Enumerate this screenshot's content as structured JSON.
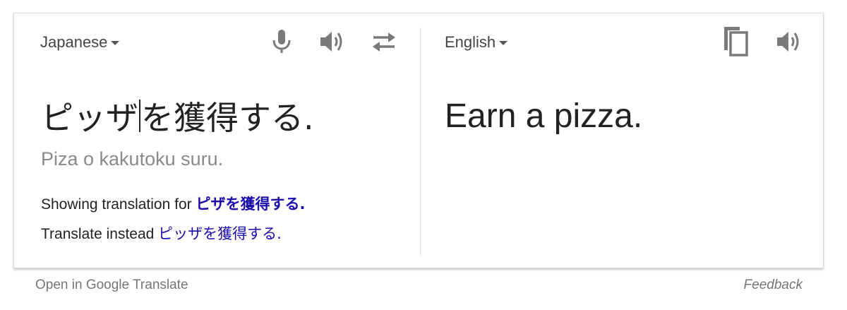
{
  "source": {
    "language": "Japanese",
    "text_before_cursor": "ピッザ",
    "text_after_cursor": "を獲得する.",
    "romanization": "Piza o kakutoku suru."
  },
  "suggestions": {
    "showing_prefix": "Showing translation for",
    "showing_link": "ピザを獲得する.",
    "instead_prefix": "Translate instead",
    "instead_link": "ピッザを獲得する."
  },
  "target": {
    "language": "English",
    "text": "Earn a pizza."
  },
  "icons": [
    "microphone-icon",
    "speaker-icon",
    "swap-languages-icon",
    "copy-icon",
    "speaker-icon"
  ],
  "colors": {
    "link": "#1a0dab",
    "icon": "#7a7a7a",
    "muted": "#8a8a8a"
  },
  "footer": {
    "open_link": "Open in Google Translate",
    "feedback": "Feedback"
  }
}
